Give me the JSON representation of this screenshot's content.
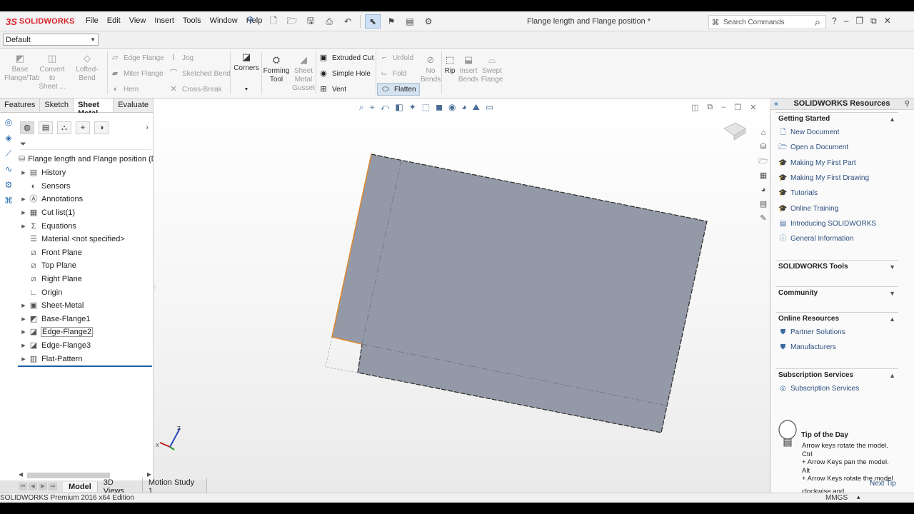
{
  "app": {
    "logo_prefix": "3S",
    "logo_name": "SOLIDWORKS",
    "menu": [
      "File",
      "Edit",
      "View",
      "Insert",
      "Tools",
      "Window",
      "Help"
    ],
    "document_title": "Flange length and Flange position *",
    "search_placeholder": "Search Commands"
  },
  "configuration": {
    "selected": "Default"
  },
  "ribbon": {
    "base_flange": {
      "line1": "Base",
      "line2": "Flange/Tab"
    },
    "convert": {
      "line1": "Convert",
      "line2": "to",
      "line3": "Sheet ..."
    },
    "lofted_bend": "Lofted-Bend",
    "edge_flange": "Edge Flange",
    "miter_flange": "Miter Flange",
    "hem": "Hem",
    "jog": "Jog",
    "sketched_bend": "Sketched Bend",
    "cross_break": "Cross-Break",
    "corners": "Corners",
    "forming_tool": {
      "line1": "Forming",
      "line2": "Tool"
    },
    "gusset": {
      "line1": "Sheet",
      "line2": "Metal",
      "line3": "Gusset"
    },
    "extruded_cut": "Extruded Cut",
    "simple_hole": "Simple Hole",
    "vent": "Vent",
    "unfold": "Unfold",
    "fold": "Fold",
    "flatten": "Flatten",
    "no_bends": {
      "line1": "No",
      "line2": "Bends"
    },
    "rip": "Rip",
    "insert_bends": {
      "line1": "Insert",
      "line2": "Bends"
    },
    "swept_flange": {
      "line1": "Swept",
      "line2": "Flange"
    }
  },
  "command_tabs": [
    "Features",
    "Sketch",
    "Sheet Metal",
    "Evaluate"
  ],
  "active_command_tab": "Sheet Metal",
  "feature_tree": {
    "root": "Flange length and Flange position  (De",
    "items": [
      {
        "label": "History",
        "icon": "history-folder-icon",
        "expandable": true
      },
      {
        "label": "Sensors",
        "icon": "sensors-icon",
        "expandable": false
      },
      {
        "label": "Annotations",
        "icon": "annotations-icon",
        "expandable": true
      },
      {
        "label": "Cut list(1)",
        "icon": "cut-list-icon",
        "expandable": true
      },
      {
        "label": "Equations",
        "icon": "equations-icon",
        "expandable": true
      },
      {
        "label": "Material <not specified>",
        "icon": "material-icon",
        "expandable": false
      },
      {
        "label": "Front Plane",
        "icon": "plane-icon",
        "expandable": false
      },
      {
        "label": "Top Plane",
        "icon": "plane-icon",
        "expandable": false
      },
      {
        "label": "Right Plane",
        "icon": "plane-icon",
        "expandable": false
      },
      {
        "label": "Origin",
        "icon": "origin-icon",
        "expandable": false
      },
      {
        "label": "Sheet-Metal",
        "icon": "sheet-metal-icon",
        "expandable": true
      },
      {
        "label": "Base-Flange1",
        "icon": "base-flange-icon",
        "expandable": true
      },
      {
        "label": "Edge-Flange2",
        "icon": "edge-flange-icon",
        "expandable": true
      },
      {
        "label": "Edge-Flange3",
        "icon": "edge-flange-icon",
        "expandable": true
      },
      {
        "label": "Flat-Pattern",
        "icon": "flat-pattern-icon",
        "expandable": true
      }
    ]
  },
  "bottom_tabs": [
    "Model",
    "3D Views",
    "Motion Study 1"
  ],
  "active_bottom_tab": "Model",
  "status": {
    "edition": "SOLIDWORKS Premium 2016 x64 Edition",
    "units": "MMGS"
  },
  "task_pane": {
    "title": "SOLIDWORKS Resources",
    "sections": [
      {
        "title": "Getting Started",
        "expanded": true,
        "links": [
          {
            "label": "New Document",
            "icon": "new-document-icon"
          },
          {
            "label": "Open a Document",
            "icon": "open-document-icon"
          },
          {
            "label": "Making My First Part",
            "icon": "tutorial-cap-icon"
          },
          {
            "label": "Making My First Drawing",
            "icon": "tutorial-cap-icon"
          },
          {
            "label": "Tutorials",
            "icon": "tutorial-cap-icon"
          },
          {
            "label": "Online Training",
            "icon": "tutorial-cap-icon"
          },
          {
            "label": "Introducing SOLIDWORKS",
            "icon": "book-icon"
          },
          {
            "label": "General Information",
            "icon": "info-icon"
          }
        ]
      },
      {
        "title": "SOLIDWORKS Tools",
        "expanded": false,
        "links": []
      },
      {
        "title": "Community",
        "expanded": false,
        "links": []
      },
      {
        "title": "Online Resources",
        "expanded": true,
        "links": [
          {
            "label": "Partner Solutions",
            "icon": "handshake-icon"
          },
          {
            "label": "Manufacturers",
            "icon": "handshake-icon"
          }
        ]
      },
      {
        "title": "Subscription Services",
        "expanded": true,
        "links": [
          {
            "label": "Subscription Services",
            "icon": "subscription-icon"
          }
        ]
      }
    ],
    "tip": {
      "title": "Tip of the Day",
      "lines": [
        "Arrow keys rotate the model. Ctrl",
        "+ Arrow Keys pan the model. Alt",
        "+ Arrow Keys rotate the model",
        "clockwise and counterclockwise."
      ],
      "next": "Next Tip"
    }
  },
  "colors": {
    "part_face": "#9499a8",
    "part_edge": "#2b2b2b",
    "selected_edge": "#e08a2c",
    "accent": "#1b5ba8"
  }
}
